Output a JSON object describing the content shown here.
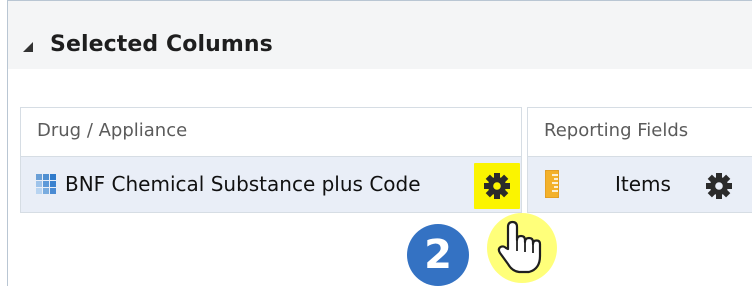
{
  "panel": {
    "title": "Selected Columns",
    "collapse_icon": "triangle-collapse-icon"
  },
  "groups": {
    "drug": {
      "title": "Drug / Appliance",
      "item": {
        "label": "BNF Chemical Substance plus Code",
        "icon": "grid-icon",
        "options_icon": "gear-icon"
      }
    },
    "reporting": {
      "title": "Reporting Fields",
      "item": {
        "label": "Items",
        "icon": "ruler-icon",
        "options_icon": "gear-icon"
      }
    }
  },
  "callout": {
    "step": "2",
    "color": "#3472c3",
    "highlight_color": "#fbf400"
  }
}
